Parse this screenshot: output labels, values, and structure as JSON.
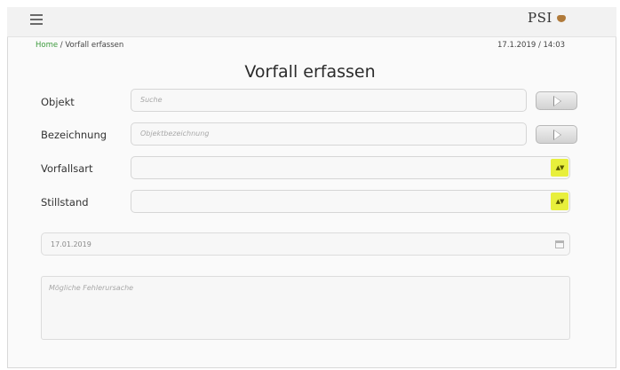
{
  "header": {
    "logo": "PSI"
  },
  "breadcrumb": {
    "home": "Home",
    "separator": " / ",
    "current": "Vorfall erfassen"
  },
  "datetime": "17.1.2019 / 14:03",
  "page_title": "Vorfall erfassen",
  "form": {
    "objekt": {
      "label": "Objekt",
      "placeholder": "Suche"
    },
    "bezeichnung": {
      "label": "Bezeichnung",
      "placeholder": "Objektbezeichnung"
    },
    "vorfallsart": {
      "label": "Vorfallsart",
      "value": ""
    },
    "stillstand": {
      "label": "Stillstand",
      "value": ""
    },
    "datum": {
      "value": "17.01.2019"
    },
    "fehlerursache": {
      "placeholder": "Mögliche Fehlerursache"
    }
  },
  "icons": {
    "menu": "hamburger-icon",
    "go": "play-triangle-icon",
    "select": "sort-arrows-icon",
    "calendar": "calendar-icon"
  },
  "colors": {
    "accent_link": "#3c9a3c",
    "select_highlight": "#e8ef3c",
    "logo_mark": "#b07a3a"
  }
}
